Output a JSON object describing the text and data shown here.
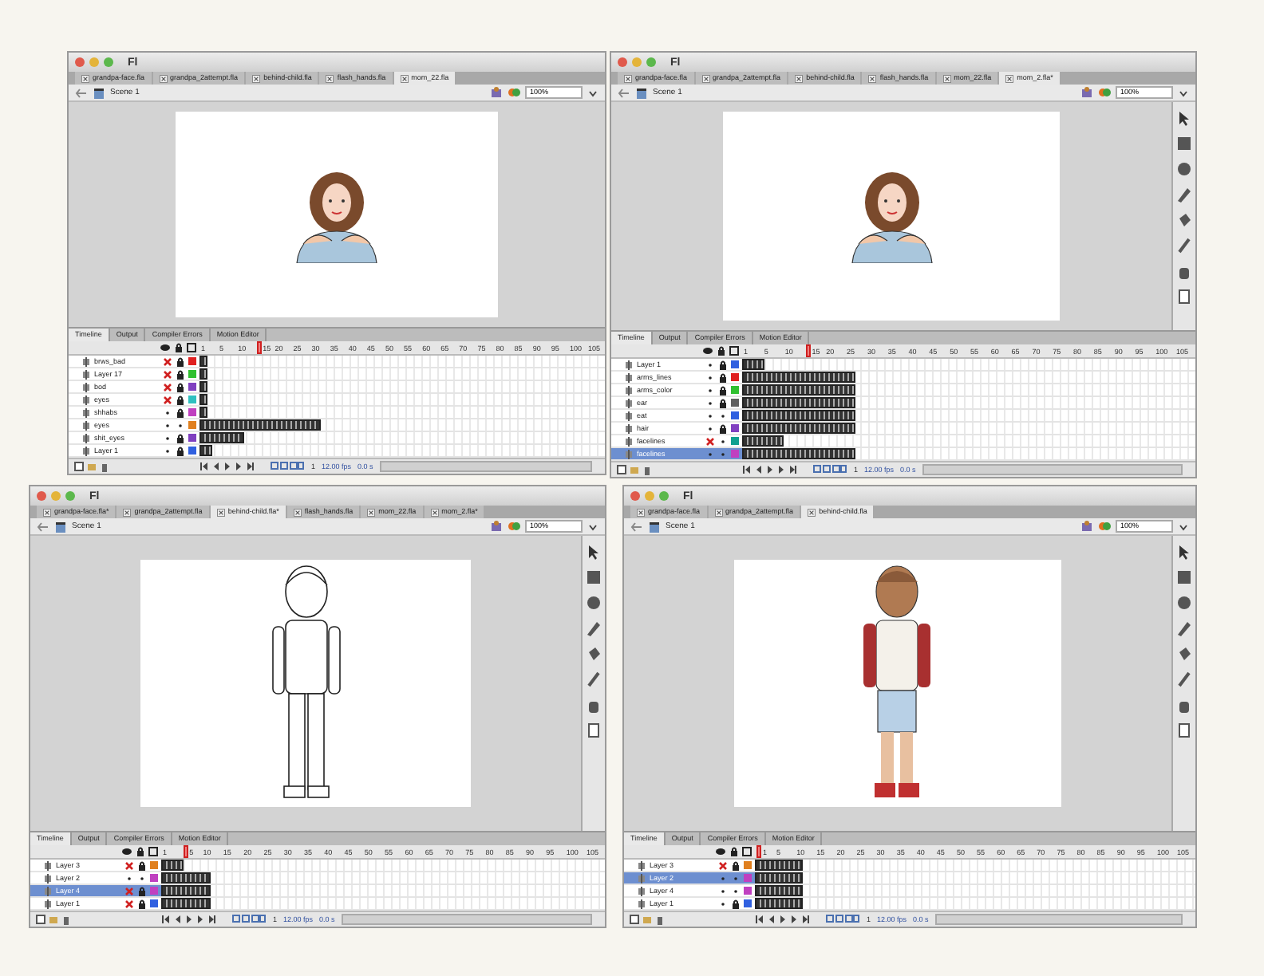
{
  "windows": [
    {
      "app": "Fl",
      "stage": {
        "kind": "mom"
      },
      "toolbar": false,
      "scene": "Scene 1",
      "zoom": "100%",
      "tabs": [
        {
          "label": "grandpa-face.fla",
          "selected": false
        },
        {
          "label": "grandpa_2attempt.fla",
          "selected": false
        },
        {
          "label": "behind-child.fla",
          "selected": false
        },
        {
          "label": "flash_hands.fla",
          "selected": false
        },
        {
          "label": "mom_22.fla",
          "selected": true
        }
      ],
      "panel_tabs": [
        {
          "label": "Timeline",
          "selected": true
        },
        {
          "label": "Output",
          "selected": false
        },
        {
          "label": "Compiler Errors",
          "selected": false
        },
        {
          "label": "Motion Editor",
          "selected": false
        }
      ],
      "frame_numbers": [
        {
          "label": "1",
          "selected": false
        },
        {
          "label": "5",
          "selected": false
        },
        {
          "label": "10",
          "selected": false
        },
        {
          "label": "15",
          "selected": true
        },
        {
          "label": "20",
          "selected": false
        },
        {
          "label": "25",
          "selected": false
        },
        {
          "label": "30",
          "selected": false
        },
        {
          "label": "35",
          "selected": false
        },
        {
          "label": "40",
          "selected": false
        },
        {
          "label": "45",
          "selected": false
        },
        {
          "label": "50",
          "selected": false
        },
        {
          "label": "55",
          "selected": false
        },
        {
          "label": "60",
          "selected": false
        },
        {
          "label": "65",
          "selected": false
        },
        {
          "label": "70",
          "selected": false
        },
        {
          "label": "75",
          "selected": false
        },
        {
          "label": "80",
          "selected": false
        },
        {
          "label": "85",
          "selected": false
        },
        {
          "label": "90",
          "selected": false
        },
        {
          "label": "95",
          "selected": false
        },
        {
          "label": "100",
          "selected": false
        },
        {
          "label": "105",
          "selected": false
        }
      ],
      "layers": [
        {
          "name": "brws_bad",
          "selected": false,
          "hidden": true,
          "locked": true,
          "color": "#e02020",
          "level": 0.02
        },
        {
          "name": "Layer 17",
          "selected": false,
          "hidden": true,
          "locked": true,
          "color": "#30c030",
          "level": 0.02
        },
        {
          "name": "bod",
          "selected": false,
          "hidden": true,
          "locked": true,
          "color": "#8040c0",
          "level": 0.02
        },
        {
          "name": "eyes",
          "selected": false,
          "hidden": true,
          "locked": true,
          "color": "#30c0c0",
          "level": 0.02
        },
        {
          "name": "shhabs",
          "selected": false,
          "hidden": false,
          "locked": true,
          "color": "#c040c0",
          "level": 0.02
        },
        {
          "name": "eyes",
          "selected": false,
          "hidden": false,
          "locked": false,
          "color": "#e08020",
          "level": 0.3
        },
        {
          "name": "shit_eyes",
          "selected": false,
          "hidden": false,
          "locked": true,
          "color": "#8040c0",
          "level": 0.11
        },
        {
          "name": "Layer 1",
          "selected": false,
          "hidden": false,
          "locked": true,
          "color": "#3060e0",
          "level": 0.03
        }
      ],
      "frame": "1",
      "fps": "12.00 fps",
      "time": "0.0 s"
    },
    {
      "app": "Fl",
      "stage": {
        "kind": "mom"
      },
      "toolbar": true,
      "scene": "Scene 1",
      "zoom": "100%",
      "tabs": [
        {
          "label": "grandpa-face.fla",
          "selected": false
        },
        {
          "label": "grandpa_2attempt.fla",
          "selected": false
        },
        {
          "label": "behind-child.fla",
          "selected": false
        },
        {
          "label": "flash_hands.fla",
          "selected": false
        },
        {
          "label": "mom_22.fla",
          "selected": false
        },
        {
          "label": "mom_2.fla*",
          "selected": true
        }
      ],
      "panel_tabs": [
        {
          "label": "Timeline",
          "selected": true
        },
        {
          "label": "Output",
          "selected": false
        },
        {
          "label": "Compiler Errors",
          "selected": false
        },
        {
          "label": "Motion Editor",
          "selected": false
        }
      ],
      "frame_numbers": [
        {
          "label": "1",
          "selected": false
        },
        {
          "label": "5",
          "selected": false
        },
        {
          "label": "10",
          "selected": false
        },
        {
          "label": "15",
          "selected": true
        },
        {
          "label": "20",
          "selected": false
        },
        {
          "label": "25",
          "selected": false
        },
        {
          "label": "30",
          "selected": false
        },
        {
          "label": "35",
          "selected": false
        },
        {
          "label": "40",
          "selected": false
        },
        {
          "label": "45",
          "selected": false
        },
        {
          "label": "50",
          "selected": false
        },
        {
          "label": "55",
          "selected": false
        },
        {
          "label": "60",
          "selected": false
        },
        {
          "label": "65",
          "selected": false
        },
        {
          "label": "70",
          "selected": false
        },
        {
          "label": "75",
          "selected": false
        },
        {
          "label": "80",
          "selected": false
        },
        {
          "label": "85",
          "selected": false
        },
        {
          "label": "90",
          "selected": false
        },
        {
          "label": "95",
          "selected": false
        },
        {
          "label": "100",
          "selected": false
        },
        {
          "label": "105",
          "selected": false
        }
      ],
      "layers": [
        {
          "name": "Layer 1",
          "selected": false,
          "hidden": false,
          "locked": true,
          "color": "#3060e0",
          "level": 0.05
        },
        {
          "name": "arms_lines",
          "selected": false,
          "hidden": false,
          "locked": true,
          "color": "#e02020",
          "level": 0.25
        },
        {
          "name": "arms_color",
          "selected": false,
          "hidden": false,
          "locked": true,
          "color": "#30c030",
          "level": 0.25
        },
        {
          "name": "ear",
          "selected": false,
          "hidden": false,
          "locked": true,
          "color": "#606060",
          "level": 0.25
        },
        {
          "name": "eat",
          "selected": false,
          "hidden": false,
          "locked": false,
          "color": "#3060e0",
          "level": 0.25
        },
        {
          "name": "hair",
          "selected": false,
          "hidden": false,
          "locked": true,
          "color": "#8040c0",
          "level": 0.25
        },
        {
          "name": "facelines",
          "selected": false,
          "hidden": true,
          "locked": false,
          "color": "#10a090",
          "level": 0.09
        },
        {
          "name": "facelines",
          "selected": true,
          "hidden": false,
          "locked": false,
          "color": "#c040c0",
          "level": 0.25
        }
      ],
      "frame": "1",
      "fps": "12.00 fps",
      "time": "0.0 s"
    },
    {
      "app": "Fl",
      "stage": {
        "kind": "child-outline"
      },
      "toolbar": true,
      "scene": "Scene 1",
      "zoom": "100%",
      "tabs": [
        {
          "label": "grandpa-face.fla*",
          "selected": false
        },
        {
          "label": "grandpa_2attempt.fla",
          "selected": false
        },
        {
          "label": "behind-child.fla*",
          "selected": true
        },
        {
          "label": "flash_hands.fla",
          "selected": false
        },
        {
          "label": "mom_22.fla",
          "selected": false
        },
        {
          "label": "mom_2.fla*",
          "selected": false
        }
      ],
      "panel_tabs": [
        {
          "label": "Timeline",
          "selected": true
        },
        {
          "label": "Output",
          "selected": false
        },
        {
          "label": "Compiler Errors",
          "selected": false
        },
        {
          "label": "Motion Editor",
          "selected": false
        }
      ],
      "frame_numbers": [
        {
          "label": "1",
          "selected": false
        },
        {
          "label": "5",
          "selected": true
        },
        {
          "label": "10",
          "selected": false
        },
        {
          "label": "15",
          "selected": false
        },
        {
          "label": "20",
          "selected": false
        },
        {
          "label": "25",
          "selected": false
        },
        {
          "label": "30",
          "selected": false
        },
        {
          "label": "35",
          "selected": false
        },
        {
          "label": "40",
          "selected": false
        },
        {
          "label": "45",
          "selected": false
        },
        {
          "label": "50",
          "selected": false
        },
        {
          "label": "55",
          "selected": false
        },
        {
          "label": "60",
          "selected": false
        },
        {
          "label": "65",
          "selected": false
        },
        {
          "label": "70",
          "selected": false
        },
        {
          "label": "75",
          "selected": false
        },
        {
          "label": "80",
          "selected": false
        },
        {
          "label": "85",
          "selected": false
        },
        {
          "label": "90",
          "selected": false
        },
        {
          "label": "95",
          "selected": false
        },
        {
          "label": "100",
          "selected": false
        },
        {
          "label": "105",
          "selected": false
        }
      ],
      "layers": [
        {
          "name": "Layer 3",
          "selected": false,
          "hidden": true,
          "locked": true,
          "color": "#e08020",
          "level": 0.05
        },
        {
          "name": "Layer 2",
          "selected": false,
          "hidden": false,
          "locked": false,
          "color": "#c040c0",
          "level": 0.11
        },
        {
          "name": "Layer 4",
          "selected": true,
          "hidden": true,
          "locked": true,
          "color": "#c040c0",
          "level": 0.11
        },
        {
          "name": "Layer 1",
          "selected": false,
          "hidden": true,
          "locked": true,
          "color": "#3060e0",
          "level": 0.11
        }
      ],
      "frame": "1",
      "fps": "12.00 fps",
      "time": "0.0 s"
    },
    {
      "app": "Fl",
      "stage": {
        "kind": "child-color"
      },
      "toolbar": true,
      "scene": "Scene 1",
      "zoom": "100%",
      "tabs": [
        {
          "label": "grandpa-face.fla",
          "selected": false
        },
        {
          "label": "grandpa_2attempt.fla",
          "selected": false
        },
        {
          "label": "behind-child.fla",
          "selected": true
        }
      ],
      "panel_tabs": [
        {
          "label": "Timeline",
          "selected": true
        },
        {
          "label": "Output",
          "selected": false
        },
        {
          "label": "Compiler Errors",
          "selected": false
        },
        {
          "label": "Motion Editor",
          "selected": false
        }
      ],
      "frame_numbers": [
        {
          "label": "1",
          "selected": true
        },
        {
          "label": "5",
          "selected": false
        },
        {
          "label": "10",
          "selected": false
        },
        {
          "label": "15",
          "selected": false
        },
        {
          "label": "20",
          "selected": false
        },
        {
          "label": "25",
          "selected": false
        },
        {
          "label": "30",
          "selected": false
        },
        {
          "label": "35",
          "selected": false
        },
        {
          "label": "40",
          "selected": false
        },
        {
          "label": "45",
          "selected": false
        },
        {
          "label": "50",
          "selected": false
        },
        {
          "label": "55",
          "selected": false
        },
        {
          "label": "60",
          "selected": false
        },
        {
          "label": "65",
          "selected": false
        },
        {
          "label": "70",
          "selected": false
        },
        {
          "label": "75",
          "selected": false
        },
        {
          "label": "80",
          "selected": false
        },
        {
          "label": "85",
          "selected": false
        },
        {
          "label": "90",
          "selected": false
        },
        {
          "label": "95",
          "selected": false
        },
        {
          "label": "100",
          "selected": false
        },
        {
          "label": "105",
          "selected": false
        }
      ],
      "layers": [
        {
          "name": "Layer 3",
          "selected": false,
          "hidden": true,
          "locked": true,
          "color": "#e08020",
          "level": 0.11
        },
        {
          "name": "Layer 2",
          "selected": true,
          "hidden": false,
          "locked": false,
          "color": "#c040c0",
          "level": 0.11
        },
        {
          "name": "Layer 4",
          "selected": false,
          "hidden": false,
          "locked": false,
          "color": "#c040c0",
          "level": 0.11
        },
        {
          "name": "Layer 1",
          "selected": false,
          "hidden": false,
          "locked": true,
          "color": "#3060e0",
          "level": 0.11
        }
      ],
      "frame": "1",
      "fps": "12.00 fps",
      "time": "0.0 s"
    }
  ]
}
